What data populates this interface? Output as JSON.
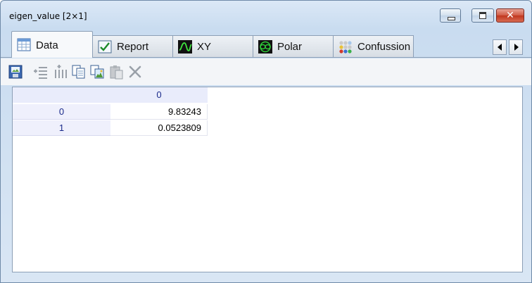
{
  "window": {
    "title": "eigen_value [2×1]",
    "close_glyph": "✕"
  },
  "tabs": [
    {
      "label": "Data",
      "icon": "table-icon",
      "active": true
    },
    {
      "label": "Report",
      "icon": "checkmark-icon",
      "active": false
    },
    {
      "label": "XY",
      "icon": "wave-icon",
      "active": false
    },
    {
      "label": "Polar",
      "icon": "polar-icon",
      "active": false
    },
    {
      "label": "Confussion",
      "icon": "dots-icon",
      "active": false
    }
  ],
  "toolbar": [
    {
      "icon": "save-image-icon",
      "enabled": true
    },
    {
      "icon": "insert-row-icon",
      "enabled": false
    },
    {
      "icon": "insert-column-icon",
      "enabled": false
    },
    {
      "icon": "copy-icon",
      "enabled": true
    },
    {
      "icon": "copy-image-icon",
      "enabled": true
    },
    {
      "icon": "paste-icon",
      "enabled": false
    },
    {
      "icon": "delete-icon",
      "enabled": false
    }
  ],
  "table": {
    "column_headers": [
      "0"
    ],
    "rows": [
      {
        "index": "0",
        "values": [
          "9.83243"
        ]
      },
      {
        "index": "1",
        "values": [
          "0.0523809"
        ]
      }
    ]
  },
  "colors": {
    "header_text": "#1a2a8a",
    "header_bg": "#e9ecfb",
    "frame": "#8c9fb6"
  }
}
